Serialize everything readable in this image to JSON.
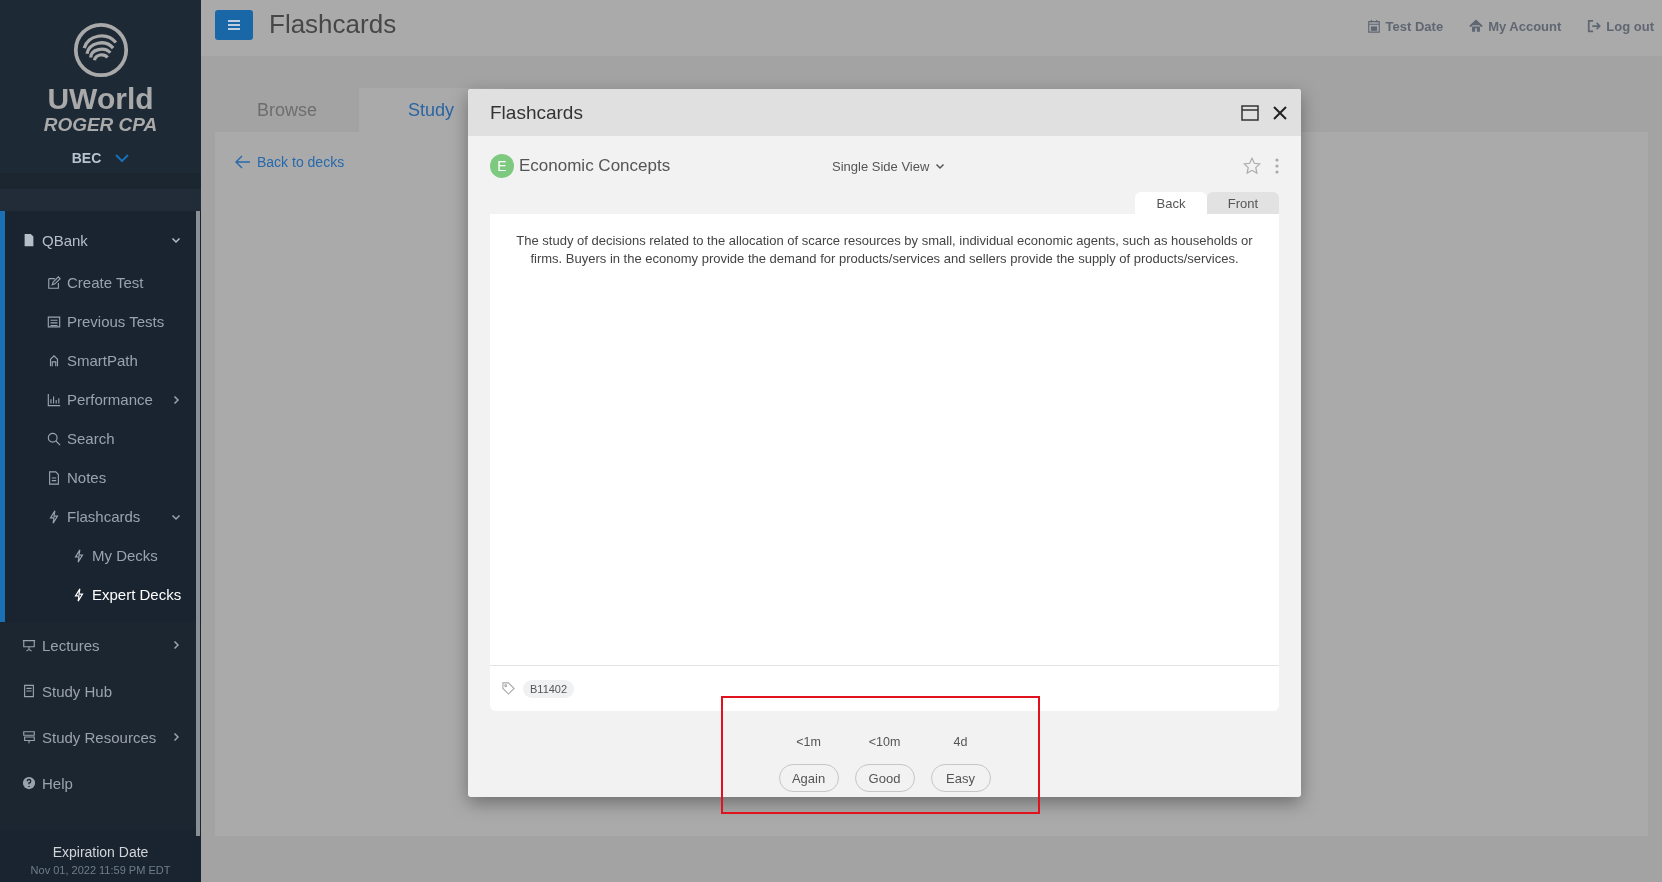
{
  "sidebar": {
    "logo": {
      "name": "UWorld",
      "subtitle": "ROGER CPA"
    },
    "section": "BEC",
    "nav": [
      {
        "label": "QBank",
        "kind": "group",
        "expanded": true,
        "selected": false,
        "children": [
          {
            "label": "Create Test",
            "kind": "link",
            "selected": false
          },
          {
            "label": "Previous Tests",
            "kind": "link",
            "selected": false
          },
          {
            "label": "SmartPath",
            "kind": "link",
            "selected": false
          },
          {
            "label": "Performance",
            "kind": "group",
            "expanded": false,
            "selected": false
          },
          {
            "label": "Search",
            "kind": "link",
            "selected": false
          },
          {
            "label": "Notes",
            "kind": "link",
            "selected": false
          },
          {
            "label": "Flashcards",
            "kind": "group",
            "expanded": true,
            "selected": false,
            "children": [
              {
                "label": "My Decks",
                "selected": false
              },
              {
                "label": "Expert Decks",
                "selected": true
              }
            ]
          }
        ]
      },
      {
        "label": "Lectures",
        "kind": "group",
        "expanded": false,
        "selected": false
      },
      {
        "label": "Study Hub",
        "kind": "link",
        "selected": false
      },
      {
        "label": "Study Resources",
        "kind": "group",
        "expanded": false,
        "selected": false
      },
      {
        "label": "Help",
        "kind": "link",
        "selected": false
      }
    ],
    "expiration": {
      "label": "Expiration Date",
      "date": "Nov 01, 2022 11:59 PM EDT"
    }
  },
  "header": {
    "title": "Flashcards",
    "links": [
      "Test Date",
      "My Account",
      "Log out"
    ]
  },
  "tabs": [
    {
      "label": "Browse",
      "selected": false
    },
    {
      "label": "Study",
      "selected": true
    }
  ],
  "back_link": "Back to decks",
  "modal": {
    "title": "Flashcards",
    "deck": {
      "badge": "E",
      "color": "#7dc97f",
      "name": "Economic Concepts"
    },
    "view_selector": "Single Side View",
    "card_tabs": [
      {
        "label": "Back",
        "selected": true
      },
      {
        "label": "Front",
        "selected": false
      }
    ],
    "card_text": "The study of decisions related to the allocation of scarce resources by small, individual economic agents, such as households or firms. Buyers in the economy provide the demand for products/services and sellers provide the supply of products/services.",
    "tags": [
      "B11402"
    ],
    "answers": [
      {
        "interval": "<1m",
        "label": "Again"
      },
      {
        "interval": "<10m",
        "label": "Good"
      },
      {
        "interval": "4d",
        "label": "Easy"
      }
    ]
  },
  "highlight": true
}
